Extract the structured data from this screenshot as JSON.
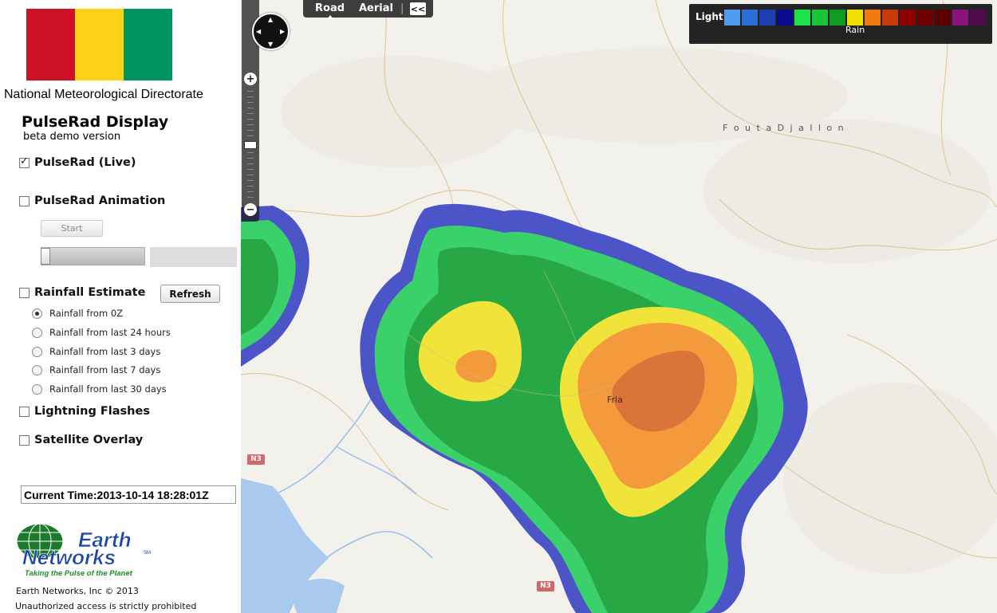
{
  "sidebar": {
    "flag_colors": [
      "#ce1126",
      "#fcd116",
      "#009460"
    ],
    "organization": "National Meteorological Directorate",
    "app_title": "PulseRad Display",
    "app_subtitle": "beta demo version",
    "layers": {
      "live": {
        "label": "PulseRad (Live)",
        "checked": true
      },
      "animation": {
        "label": "PulseRad Animation",
        "checked": false
      },
      "rainfall": {
        "label": "Rainfall Estimate",
        "checked": false
      },
      "lightning": {
        "label": "Lightning Flashes",
        "checked": false
      },
      "satellite": {
        "label": "Satellite Overlay",
        "checked": false
      }
    },
    "start_label": "Start",
    "refresh_label": "Refresh",
    "rainfall_options": [
      {
        "label": "Rainfall from 0Z",
        "selected": true
      },
      {
        "label": "Rainfall from last 24 hours",
        "selected": false
      },
      {
        "label": "Rainfall from last 3 days",
        "selected": false
      },
      {
        "label": "Rainfall from last 7 days",
        "selected": false
      },
      {
        "label": "Rainfall from last 30 days",
        "selected": false
      }
    ],
    "current_time": "Current Time:2013-10-14 18:28:01Z",
    "logo": {
      "line1": "Earth",
      "line2": "Networks",
      "tagline": "Taking the Pulse of the Planet",
      "mark": "SM"
    },
    "copyright": "Earth Networks, Inc © 2013",
    "warning": "Unauthorized access is strictly prohibited"
  },
  "map": {
    "map_types": {
      "road": "Road",
      "aerial": "Aerial",
      "separator": "|",
      "collapse": "<<"
    },
    "legend": {
      "light_label": "Light",
      "rain_label": "Rain",
      "colors": [
        "#4f9cf0",
        "#2e6fd6",
        "#1e3fb0",
        "#0a0a8c",
        "#1fe34a",
        "#19c43a",
        "#0f9a24",
        "#f2e100",
        "#f07a10",
        "#c83a08",
        "#8c0000",
        "#700000",
        "#5a0000",
        "#88137a",
        "#520a4e"
      ]
    },
    "labels": {
      "region": "F o u t a   D j a l l o n",
      "city": "Fria",
      "road1": "N3",
      "road2": "N3"
    }
  }
}
